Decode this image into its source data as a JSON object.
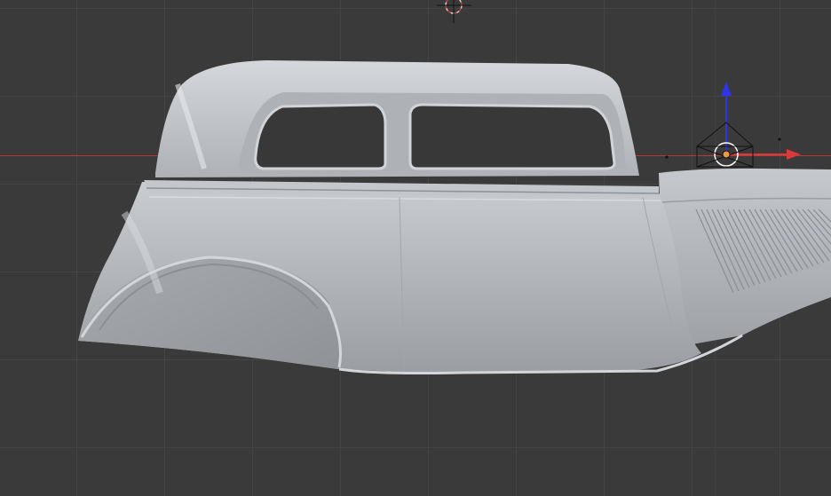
{
  "app": {
    "name": "",
    "view": "3D viewport"
  },
  "viewport": {
    "background": "#3a3a3a",
    "grid_color": "#444444",
    "x_axis_color": "#c93b3b",
    "y_axis_color": "#2e2ed6",
    "object_color": "#b9bcc1"
  },
  "scene": {
    "object": {
      "name": "",
      "kind": "car-body mesh (side view)"
    },
    "cursor_3d": {
      "icon": "3d-cursor-icon"
    },
    "manipulator": {
      "icon": "translate-gizmo-icon",
      "axes": [
        "x",
        "z"
      ]
    },
    "origin": {
      "icon": "object-origin-icon",
      "color": "#e69b3c"
    }
  }
}
